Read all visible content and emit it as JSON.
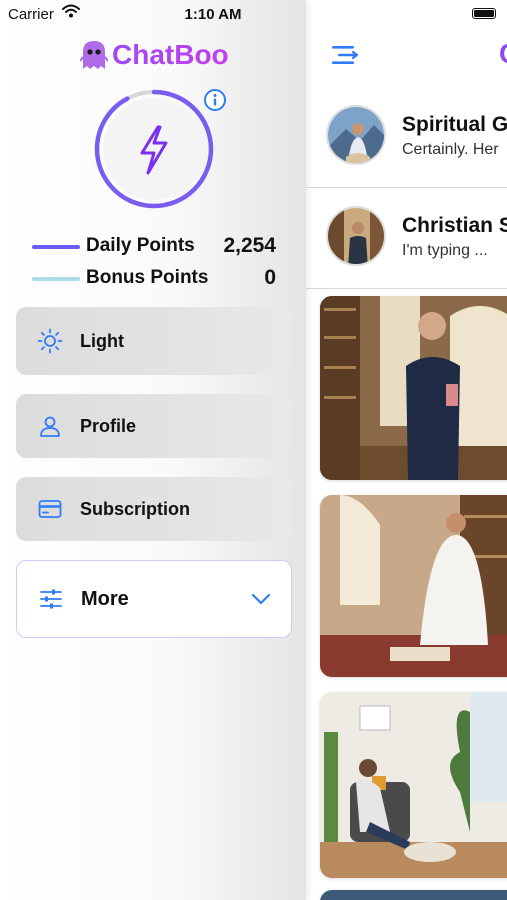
{
  "status": {
    "carrier": "Carrier",
    "time": "1:10 AM"
  },
  "drawer": {
    "app_title": "ChatBoo",
    "points": [
      {
        "label": "Daily Points",
        "value": "2,254",
        "color": "#6a5cf5"
      },
      {
        "label": "Bonus Points",
        "value": "0",
        "color": "#aedbe7"
      }
    ],
    "menu": [
      {
        "label": "Light",
        "icon": "sun-icon"
      },
      {
        "label": "Profile",
        "icon": "person-icon"
      },
      {
        "label": "Subscription",
        "icon": "card-icon"
      },
      {
        "label": "More",
        "icon": "sliders-icon"
      }
    ]
  },
  "main": {
    "brand_initial": "C",
    "chats": [
      {
        "title": "Spiritual G",
        "subtitle": "Certainly. Her"
      },
      {
        "title": "Christian S",
        "subtitle": "I'm typing ..."
      }
    ]
  },
  "colors": {
    "accent_blue": "#2f7cf6",
    "brand_purple": "#a14af0",
    "energy_purple": "#7b2ff0"
  }
}
